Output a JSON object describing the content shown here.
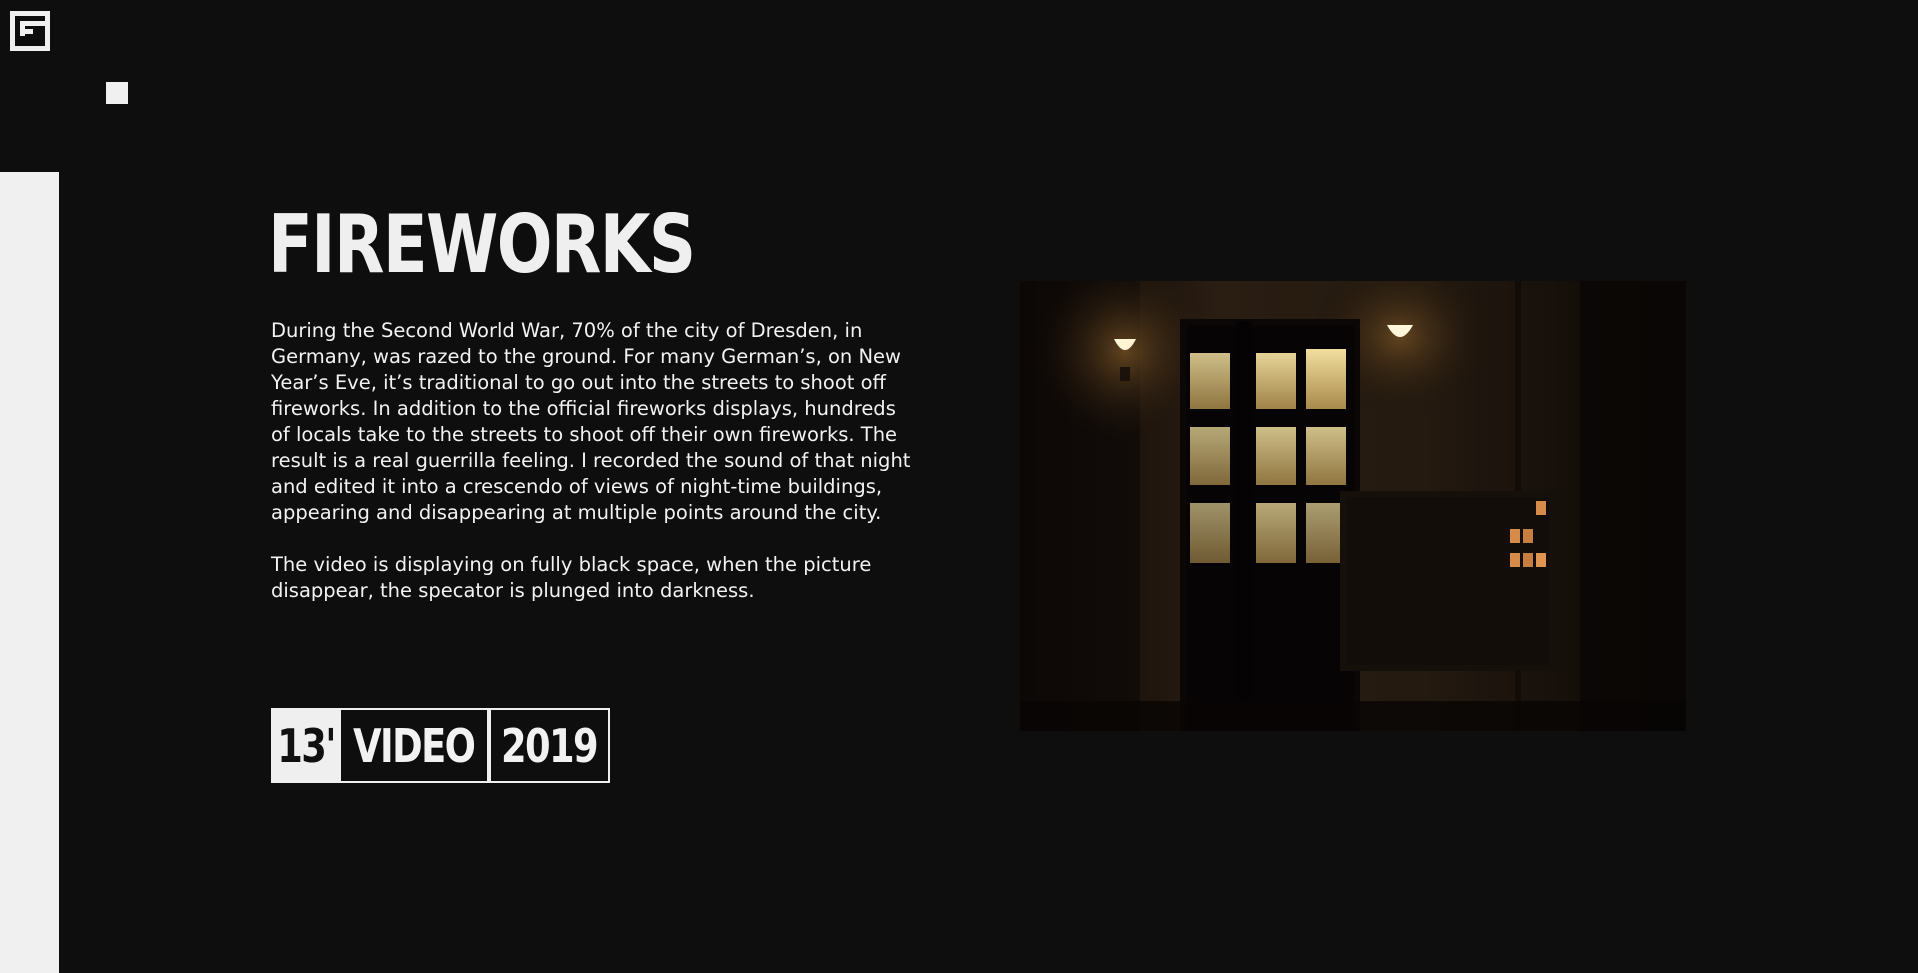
{
  "brand": {
    "logo_icon": "monogram-logo-icon"
  },
  "nav": {
    "menu_icon": "square-menu-icon"
  },
  "project": {
    "title": "FIREWORKS",
    "paragraphs": [
      "During the Second World War, 70% of the city of Dresden, in Germany, was razed to the ground. For many German’s, on New Year’s Eve, it’s traditional to go out into the streets to shoot off fireworks. In addition to the official fireworks displays, hundreds of locals take to the streets to shoot off their own fireworks. The result is a real guerrilla feeling. I recorded the sound of that night and edited it into a crescendo of views of night-time buildings, appearing and disappearing at multiple points around the city.",
      "The video is displaying on fully black space, when the picture disappear, the specator is plunged into darkness."
    ],
    "meta": {
      "duration": "13'",
      "type": "VIDEO",
      "year": "2019"
    }
  },
  "media": {
    "still_description_icon": "video-still-image"
  },
  "colors": {
    "background": "#0f0e0f",
    "foreground": "#f0f0f0",
    "lamp_glow": "#f5d48a"
  }
}
